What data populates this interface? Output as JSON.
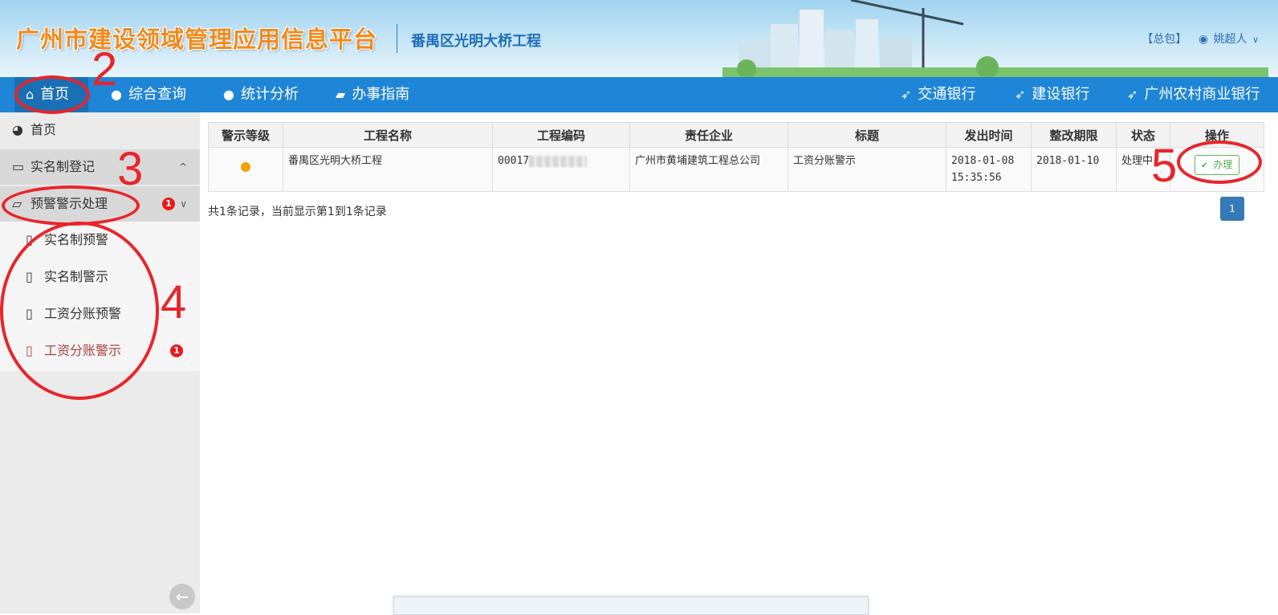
{
  "header": {
    "title": "广州市建设领域管理应用信息平台",
    "project": "番禺区光明大桥工程",
    "role_link": "【总包】",
    "user_name": "姚超人",
    "user_caret": "∨"
  },
  "nav": {
    "items": [
      {
        "label": "首页",
        "icon": "home-icon"
      },
      {
        "label": "综合查询",
        "icon": "globe-icon"
      },
      {
        "label": "统计分析",
        "icon": "globe-icon"
      },
      {
        "label": "办事指南",
        "icon": "book-icon"
      },
      {
        "label": "交通银行",
        "icon": "send-icon"
      },
      {
        "label": "建设银行",
        "icon": "send-icon"
      },
      {
        "label": "广州农村商业银行",
        "icon": "send-icon"
      }
    ]
  },
  "sidebar": {
    "home": "首页",
    "groups": [
      {
        "label": "实名制登记",
        "chevron": "^"
      },
      {
        "label": "预警警示处理",
        "badge": "1",
        "chevron": "∨"
      }
    ],
    "sub_items": [
      {
        "label": "实名制预警"
      },
      {
        "label": "实名制警示"
      },
      {
        "label": "工资分账预警"
      },
      {
        "label": "工资分账警示",
        "badge": "1",
        "active": true
      }
    ],
    "back_icon": "arrow-left-icon"
  },
  "table": {
    "headers": [
      "警示等级",
      "工程名称",
      "工程编码",
      "责任企业",
      "标题",
      "发出时间",
      "整改期限",
      "状态",
      "操作"
    ],
    "rows": [
      {
        "level_color": "#f3a10a",
        "project_name": "番禺区光明大桥工程",
        "project_code": "0001",
        "company": "广州市黄埔建筑工程总公司",
        "title": "工资分账警示",
        "issued_time": "2018-01-08 15:35:56",
        "deadline": "2018-01-10",
        "status": "处理中",
        "action": "办理"
      }
    ]
  },
  "summary": "共1条记录，当前显示第1到1条记录",
  "pager": {
    "current": "1"
  },
  "annotations": {
    "n2": "2",
    "n3": "3",
    "n4": "4",
    "n5": "5"
  },
  "colors": {
    "nav": "#1f85d6",
    "annotation": "#e8252b",
    "badge": "#e51c1c"
  }
}
